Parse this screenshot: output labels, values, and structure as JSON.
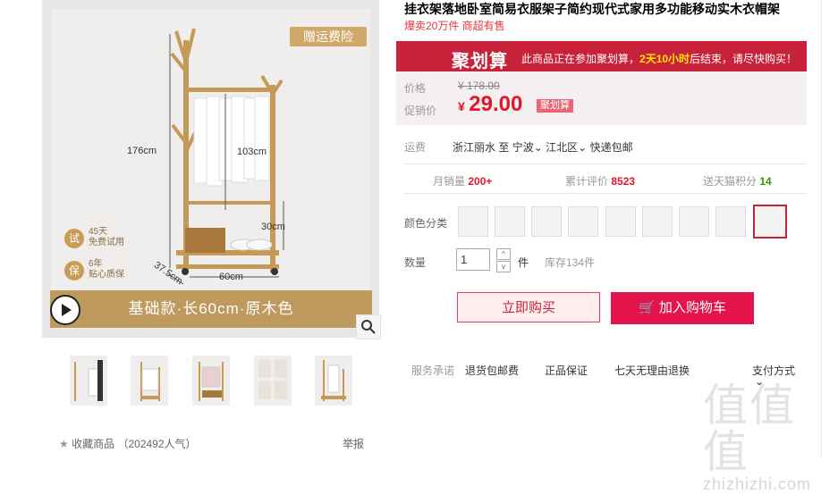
{
  "gallery": {
    "gift_badge": "赠运费险",
    "dims": {
      "height": "176cm",
      "hanger_height": "103cm",
      "shelf_height": "30cm",
      "width": "60cm",
      "depth": "37.5cm"
    },
    "trial_badge": {
      "icon": "试",
      "line1": "45天",
      "line2": "免费试用"
    },
    "warranty_badge": {
      "icon": "保",
      "line1": "6年",
      "line2": "贴心质保"
    },
    "caption": "基础款·长60cm·原木色",
    "thumbnails": [
      "thumb-1",
      "thumb-2",
      "thumb-3",
      "thumb-4",
      "thumb-5"
    ]
  },
  "favorite": {
    "label": "收藏商品",
    "count": "（202492人气）"
  },
  "report_label": "举报",
  "product": {
    "title": "挂衣架落地卧室简易衣服架子简约现代式家用多功能移动实木衣帽架",
    "subtitle": "爆卖20万件 商超有售"
  },
  "juhuasuan": {
    "logo": "聚划算",
    "notice_prefix": "此商品正在参加聚划算，",
    "notice_time": "2天10小时",
    "notice_suffix": "后结束，请尽快购买！"
  },
  "price": {
    "orig_label": "价格",
    "orig_value": "¥ 178.00",
    "promo_label": "促销价",
    "currency": "¥",
    "promo_value": "29.00",
    "promo_tag": "聚划算"
  },
  "shipping": {
    "label": "运费",
    "from": "浙江丽水",
    "to_word": "至",
    "city": "宁波",
    "district": "江北区",
    "fee": "快递包邮"
  },
  "stats": {
    "monthly_label": "月销量",
    "monthly_value": "200+",
    "reviews_label": "累计评价",
    "reviews_value": "8523",
    "points_label": "送天猫积分",
    "points_value": "14"
  },
  "color": {
    "label": "颜色分类",
    "swatch_count": 9,
    "selected_index": 8
  },
  "quantity": {
    "label": "数量",
    "value": "1",
    "unit": "件",
    "stock": "库存134件",
    "up": "^",
    "down": "v"
  },
  "buttons": {
    "buy_now": "立即购买",
    "add_cart": "加入购物车"
  },
  "services": {
    "label": "服务承诺",
    "items": [
      "退货包邮费",
      "正品保证",
      "七天无理由退换"
    ],
    "payment": "支付方式"
  },
  "watermark": {
    "logo": "值",
    "domain": "zhizhizhi.com"
  },
  "colors": {
    "accent": "#c8223a",
    "price": "#e4142b",
    "gold": "#bf9a5e"
  }
}
